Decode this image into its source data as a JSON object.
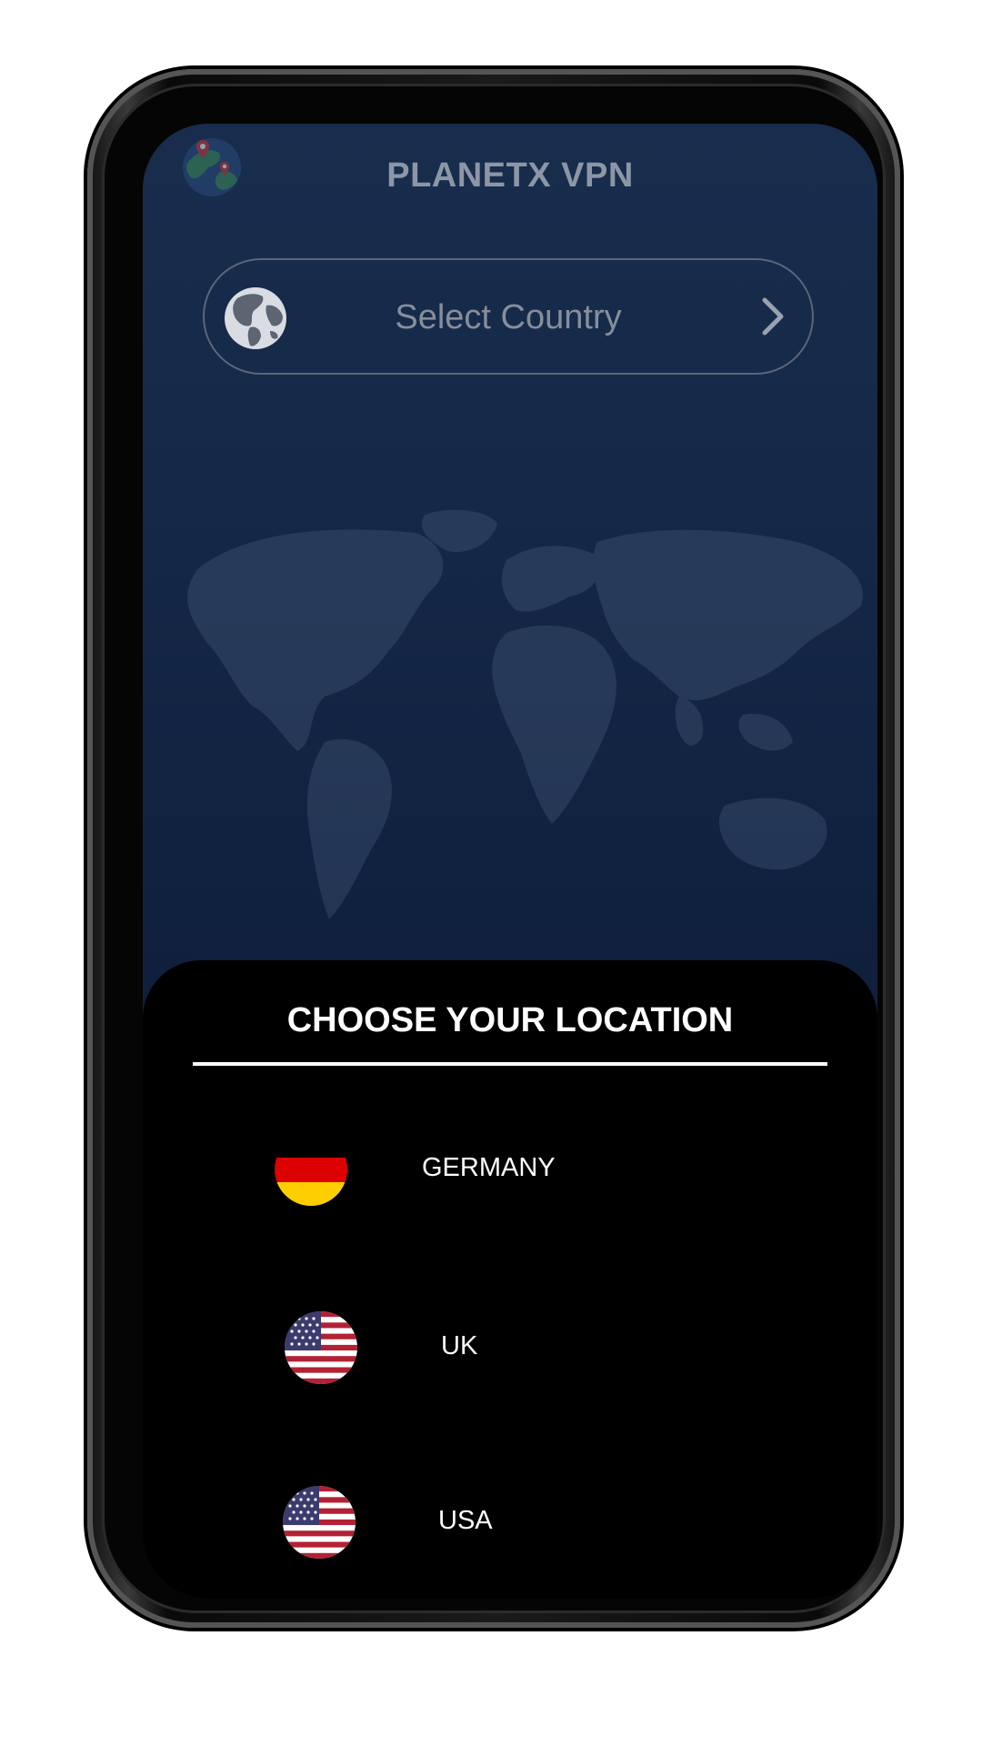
{
  "app": {
    "title": "PLANETX VPN"
  },
  "country_select": {
    "label": "Select Country"
  },
  "sheet": {
    "title": "CHOOSE YOUR LOCATION",
    "locations": [
      {
        "name": "GERMANY",
        "flag": "germany-flag-icon"
      },
      {
        "name": "UK",
        "flag": "usa-flag-icon"
      },
      {
        "name": "USA",
        "flag": "usa-flag-icon"
      }
    ]
  },
  "colors": {
    "background_top": "#182d4d",
    "background_bottom": "#0c162b",
    "sheet": "#000000",
    "text": "#ffffff",
    "muted_text": "#8c96a6"
  }
}
